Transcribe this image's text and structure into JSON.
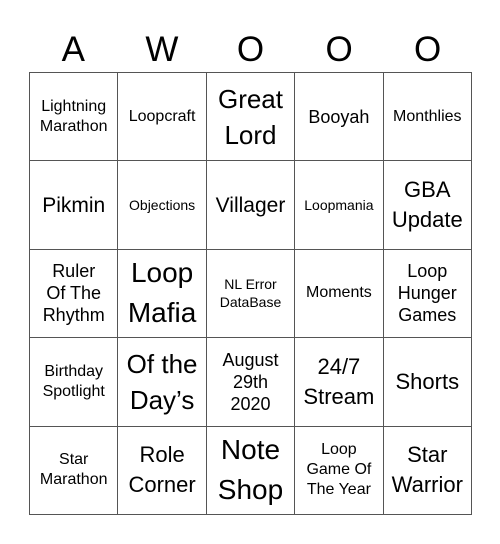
{
  "header": {
    "letters": [
      "A",
      "W",
      "O",
      "O",
      "O"
    ]
  },
  "cells": [
    {
      "text": "Lightning\nMarathon",
      "size": "s2"
    },
    {
      "text": "Loopcraft",
      "size": "s2"
    },
    {
      "text": "Great\nLord",
      "size": "s6"
    },
    {
      "text": "Booyah",
      "size": "s3"
    },
    {
      "text": "Monthlies",
      "size": "s2"
    },
    {
      "text": "Pikmin",
      "size": "s4"
    },
    {
      "text": "Objections",
      "size": "s1"
    },
    {
      "text": "Villager",
      "size": "s4"
    },
    {
      "text": "Loopmania",
      "size": "s1"
    },
    {
      "text": "GBA\nUpdate",
      "size": "s5"
    },
    {
      "text": "Ruler\nOf The\nRhythm",
      "size": "s3"
    },
    {
      "text": "Loop\nMafia",
      "size": "s7"
    },
    {
      "text": "NL Error\nDataBase",
      "size": "s1"
    },
    {
      "text": "Moments",
      "size": "s2"
    },
    {
      "text": "Loop\nHunger\nGames",
      "size": "s3"
    },
    {
      "text": "Birthday\nSpotlight",
      "size": "s2"
    },
    {
      "text": "Of the\nDay’s",
      "size": "s6"
    },
    {
      "text": "August\n29th\n2020",
      "size": "s3"
    },
    {
      "text": "24/7\nStream",
      "size": "s5"
    },
    {
      "text": "Shorts",
      "size": "s5"
    },
    {
      "text": "Star\nMarathon",
      "size": "s2"
    },
    {
      "text": "Role\nCorner",
      "size": "s5"
    },
    {
      "text": "Note\nShop",
      "size": "s7"
    },
    {
      "text": "Loop\nGame Of\nThe Year",
      "size": "s2"
    },
    {
      "text": "Star\nWarrior",
      "size": "s5"
    }
  ]
}
